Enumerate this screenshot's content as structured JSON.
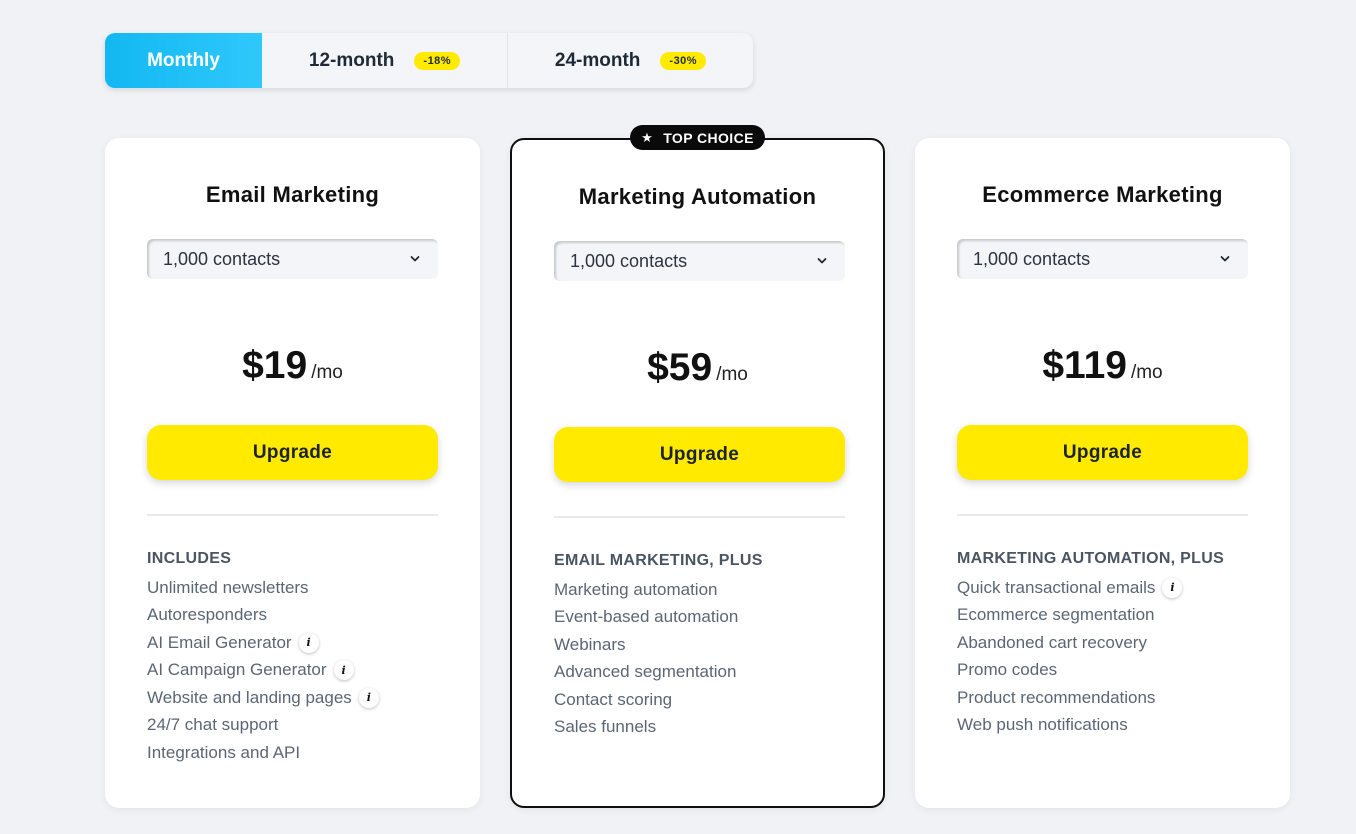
{
  "billing": {
    "options": [
      {
        "label": "Monthly"
      },
      {
        "label": "12-month",
        "badge": "-18%"
      },
      {
        "label": "24-month",
        "badge": "-30%"
      }
    ],
    "selected": "Monthly"
  },
  "top_choice_label": "TOP CHOICE",
  "plans": [
    {
      "title": "Email Marketing",
      "contacts": "1,000 contacts",
      "price": "$19",
      "period": "/mo",
      "cta": "Upgrade",
      "features_heading": "INCLUDES",
      "features": [
        {
          "label": "Unlimited newsletters"
        },
        {
          "label": "Autoresponders"
        },
        {
          "label": "AI Email Generator",
          "info": "i"
        },
        {
          "label": "AI Campaign Generator",
          "info": "i"
        },
        {
          "label": "Website and landing pages",
          "info": "i"
        },
        {
          "label": "24/7 chat support"
        },
        {
          "label": "Integrations and API"
        }
      ]
    },
    {
      "title": "Marketing Automation",
      "contacts": "1,000 contacts",
      "price": "$59",
      "period": "/mo",
      "cta": "Upgrade",
      "features_heading": "EMAIL MARKETING, PLUS",
      "features": [
        {
          "label": "Marketing automation"
        },
        {
          "label": "Event-based automation"
        },
        {
          "label": "Webinars"
        },
        {
          "label": "Advanced segmentation"
        },
        {
          "label": "Contact scoring"
        },
        {
          "label": "Sales funnels"
        }
      ]
    },
    {
      "title": "Ecommerce Marketing",
      "contacts": "1,000 contacts",
      "price": "$119",
      "period": "/mo",
      "cta": "Upgrade",
      "features_heading": "MARKETING AUTOMATION, PLUS",
      "features": [
        {
          "label": "Quick transactional emails",
          "info": "i"
        },
        {
          "label": "Ecommerce segmentation"
        },
        {
          "label": "Abandoned cart recovery"
        },
        {
          "label": "Promo codes"
        },
        {
          "label": "Product recommendations"
        },
        {
          "label": "Web push notifications"
        }
      ]
    }
  ],
  "colors": {
    "accent_blue": "#12b8f2",
    "cta_yellow": "#ffea00",
    "background": "#f1f2f6"
  }
}
